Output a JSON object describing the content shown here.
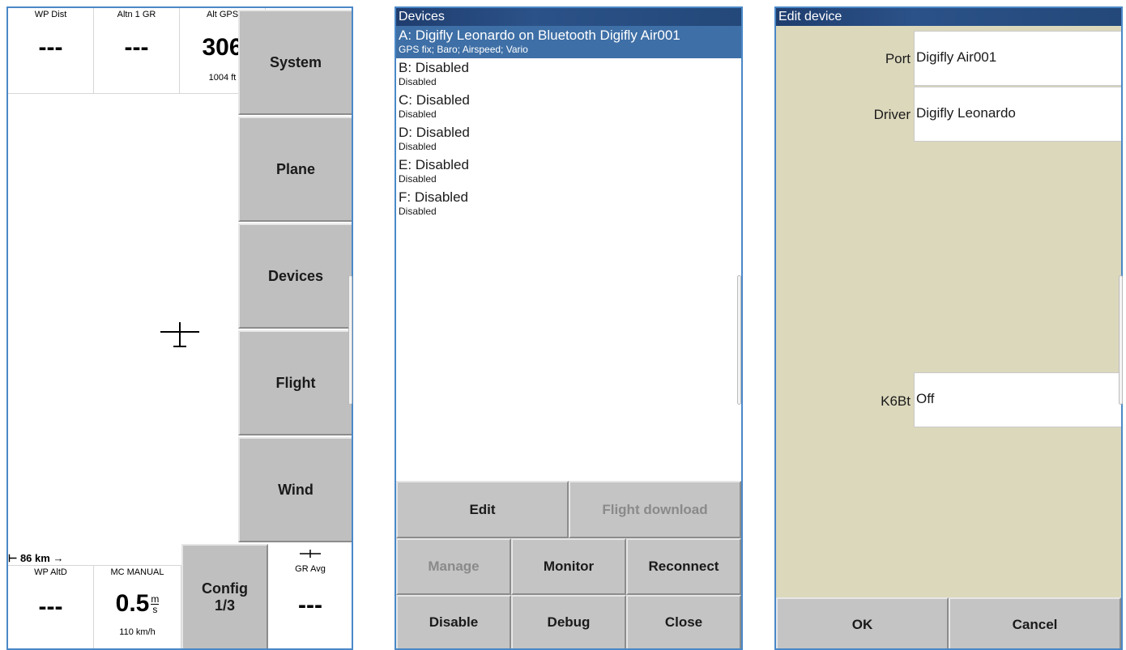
{
  "map_panel": {
    "infoboxes_top": [
      {
        "title": "WP Dist",
        "value": "---",
        "comment": ""
      },
      {
        "title": "Altn 1 GR",
        "value": "---",
        "comment": ""
      },
      {
        "title": "Alt GPS",
        "value": "306",
        "comment": "1004 ft"
      }
    ],
    "infoboxes_bottom": [
      {
        "title": "WP AltD",
        "value": "---",
        "comment": ""
      },
      {
        "title": "MC MANUAL",
        "value": "0.5",
        "unit_top": "m",
        "unit_bottom": "s",
        "comment": "110 km/h"
      },
      {
        "title": "GR Avg",
        "value": "---",
        "comment": ""
      }
    ],
    "menu_buttons": [
      "System",
      "Plane",
      "Devices",
      "Flight",
      "Wind"
    ],
    "config_button": {
      "line1": "Config",
      "line2": "1/3"
    },
    "scale_label": "86 km"
  },
  "devices_panel": {
    "title": "Devices",
    "devices": [
      {
        "name": "A: Digifly Leonardo on Bluetooth Digifly Air001",
        "status": "GPS fix; Baro; Airspeed; Vario",
        "selected": true
      },
      {
        "name": "B: Disabled",
        "status": "Disabled",
        "selected": false
      },
      {
        "name": "C: Disabled",
        "status": "Disabled",
        "selected": false
      },
      {
        "name": "D: Disabled",
        "status": "Disabled",
        "selected": false
      },
      {
        "name": "E: Disabled",
        "status": "Disabled",
        "selected": false
      },
      {
        "name": "F: Disabled",
        "status": "Disabled",
        "selected": false
      }
    ],
    "buttons": {
      "edit": "Edit",
      "flight_download": "Flight download",
      "manage": "Manage",
      "monitor": "Monitor",
      "reconnect": "Reconnect",
      "disable": "Disable",
      "debug": "Debug",
      "close": "Close"
    }
  },
  "edit_panel": {
    "title": "Edit device",
    "fields": {
      "port": {
        "label": "Port",
        "value": "Digifly Air001"
      },
      "driver": {
        "label": "Driver",
        "value": "Digifly Leonardo"
      },
      "k6bt": {
        "label": "K6Bt",
        "value": "Off"
      }
    },
    "buttons": {
      "ok": "OK",
      "cancel": "Cancel"
    }
  },
  "colors": {
    "frame_border": "#4a88c7",
    "titlebar": "#2b5289",
    "selected_row": "#3e6fa6",
    "button_face": "#c4c4c4",
    "dialog_background": "#dcd8bc"
  }
}
